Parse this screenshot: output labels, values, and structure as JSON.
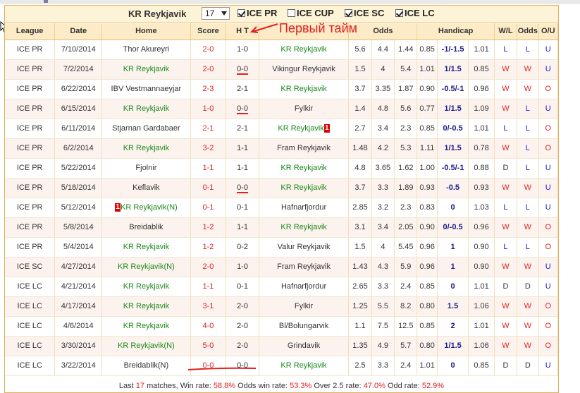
{
  "header": {
    "team": "KR Reykjavik",
    "count_value": "17",
    "filters": [
      {
        "label": "ICE PR",
        "checked": true
      },
      {
        "label": "ICE CUP",
        "checked": false
      },
      {
        "label": "ICE SC",
        "checked": true
      },
      {
        "label": "ICE LC",
        "checked": true
      }
    ]
  },
  "annotation": "Первый тайм",
  "columns": [
    "League",
    "Date",
    "Home",
    "Score",
    "H T",
    "Away",
    "Odds",
    "Handicap",
    "W/L",
    "Odds",
    "O/U"
  ],
  "rows": [
    {
      "league": "ICE PR",
      "date": "7/10/2014",
      "home": "Thor Akureyri",
      "home_team": false,
      "home_redcard": "",
      "score": "2-0",
      "ht": "1-0",
      "ht_marked": false,
      "away": "KR Reykjavik",
      "away_team": true,
      "away_redcard": "",
      "o1": "5.6",
      "o2": "4.4",
      "o3": "1.44",
      "h1": "0.85",
      "h2": "-1/-1.5",
      "h3": "1.01",
      "wl": "L",
      "odds": "L",
      "ou": "U"
    },
    {
      "league": "ICE PR",
      "date": "7/2/2014",
      "home": "KR Reykjavik",
      "home_team": true,
      "home_redcard": "",
      "score": "2-0",
      "ht": "0-0",
      "ht_marked": true,
      "away": "Vikingur Reykjavik",
      "away_team": false,
      "away_redcard": "",
      "o1": "1.5",
      "o2": "4",
      "o3": "5.4",
      "h1": "1.01",
      "h2": "1/1.5",
      "h3": "0.85",
      "wl": "W",
      "odds": "W",
      "ou": "U"
    },
    {
      "league": "ICE PR",
      "date": "6/22/2014",
      "home": "IBV Vestmannaeyjar",
      "home_team": false,
      "home_redcard": "",
      "score": "2-3",
      "ht": "2-1",
      "ht_marked": false,
      "away": "KR Reykjavik",
      "away_team": true,
      "away_redcard": "",
      "o1": "3.7",
      "o2": "3.35",
      "o3": "1.87",
      "h1": "0.90",
      "h2": "-0.5/-1",
      "h3": "0.96",
      "wl": "W",
      "odds": "W",
      "ou": "O"
    },
    {
      "league": "ICE PR",
      "date": "6/15/2014",
      "home": "KR Reykjavik",
      "home_team": true,
      "home_redcard": "",
      "score": "1-0",
      "ht": "0-0",
      "ht_marked": true,
      "away": "Fylkir",
      "away_team": false,
      "away_redcard": "",
      "o1": "1.4",
      "o2": "4.8",
      "o3": "5.6",
      "h1": "0.77",
      "h2": "1/1.5",
      "h3": "1.09",
      "wl": "W",
      "odds": "L",
      "ou": "U"
    },
    {
      "league": "ICE PR",
      "date": "6/11/2014",
      "home": "Stjarnan Gardabaer",
      "home_team": false,
      "home_redcard": "",
      "score": "2-1",
      "ht": "2-1",
      "ht_marked": false,
      "away": "KR Reykjavik",
      "away_team": true,
      "away_redcard": "1",
      "o1": "2.7",
      "o2": "3.4",
      "o3": "2.3",
      "h1": "0.85",
      "h2": "0/-0.5",
      "h3": "1.01",
      "wl": "L",
      "odds": "L",
      "ou": "O"
    },
    {
      "league": "ICE PR",
      "date": "6/2/2014",
      "home": "KR Reykjavik",
      "home_team": true,
      "home_redcard": "",
      "score": "3-2",
      "ht": "1-1",
      "ht_marked": false,
      "away": "Fram Reykjavik",
      "away_team": false,
      "away_redcard": "",
      "o1": "1.48",
      "o2": "4.2",
      "o3": "5.3",
      "h1": "1.11",
      "h2": "1/1.5",
      "h3": "0.78",
      "wl": "W",
      "odds": "L",
      "ou": "O"
    },
    {
      "league": "ICE PR",
      "date": "5/22/2014",
      "home": "Fjolnir",
      "home_team": false,
      "home_redcard": "",
      "score": "1-1",
      "ht": "1-1",
      "ht_marked": false,
      "away": "KR Reykjavik",
      "away_team": true,
      "away_redcard": "",
      "o1": "4.8",
      "o2": "3.65",
      "o3": "1.62",
      "h1": "1.00",
      "h2": "-0.5/-1",
      "h3": "0.88",
      "wl": "D",
      "odds": "L",
      "ou": "U"
    },
    {
      "league": "ICE PR",
      "date": "5/18/2014",
      "home": "Keflavik",
      "home_team": false,
      "home_redcard": "",
      "score": "0-1",
      "ht": "0-0",
      "ht_marked": true,
      "away": "KR Reykjavik",
      "away_team": true,
      "away_redcard": "",
      "o1": "3.7",
      "o2": "3.3",
      "o3": "1.89",
      "h1": "0.93",
      "h2": "-0.5",
      "h3": "0.93",
      "wl": "W",
      "odds": "W",
      "ou": "U"
    },
    {
      "league": "ICE PR",
      "date": "5/12/2014",
      "home": "KR Reykjavik(N)",
      "home_team": true,
      "home_redcard": "1",
      "score": "0-1",
      "ht": "0-1",
      "ht_marked": false,
      "away": "Hafnarfjordur",
      "away_team": false,
      "away_redcard": "",
      "o1": "2.85",
      "o2": "3.2",
      "o3": "2.3",
      "h1": "0.83",
      "h2": "0",
      "h3": "1.03",
      "wl": "L",
      "odds": "L",
      "ou": "U"
    },
    {
      "league": "ICE PR",
      "date": "5/8/2014",
      "home": "Breidablik",
      "home_team": false,
      "home_redcard": "",
      "score": "1-2",
      "ht": "1-1",
      "ht_marked": false,
      "away": "KR Reykjavik",
      "away_team": true,
      "away_redcard": "",
      "o1": "3.1",
      "o2": "3.4",
      "o3": "2.05",
      "h1": "0.90",
      "h2": "0/-0.5",
      "h3": "0.96",
      "wl": "W",
      "odds": "W",
      "ou": "O"
    },
    {
      "league": "ICE PR",
      "date": "5/4/2014",
      "home": "KR Reykjavik",
      "home_team": true,
      "home_redcard": "",
      "score": "1-2",
      "ht": "0-2",
      "ht_marked": false,
      "away": "Valur Reykjavik",
      "away_team": false,
      "away_redcard": "",
      "o1": "1.5",
      "o2": "4",
      "o3": "5.45",
      "h1": "0.96",
      "h2": "1",
      "h3": "0.90",
      "wl": "L",
      "odds": "L",
      "ou": "O"
    },
    {
      "league": "ICE SC",
      "date": "4/27/2014",
      "home": "KR Reykjavik(N)",
      "home_team": true,
      "home_redcard": "",
      "score": "2-0",
      "ht": "1-0",
      "ht_marked": false,
      "away": "Fram Reykjavik",
      "away_team": false,
      "away_redcard": "",
      "o1": "1.43",
      "o2": "4.3",
      "o3": "5.9",
      "h1": "0.96",
      "h2": "1",
      "h3": "0.90",
      "wl": "W",
      "odds": "W",
      "ou": "U"
    },
    {
      "league": "ICE LC",
      "date": "4/21/2014",
      "home": "KR Reykjavik",
      "home_team": true,
      "home_redcard": "",
      "score": "1-1",
      "ht": "0-1",
      "ht_marked": false,
      "away": "Hafnarfjordur",
      "away_team": false,
      "away_redcard": "",
      "o1": "2.65",
      "o2": "3.3",
      "o3": "2.4",
      "h1": "0.85",
      "h2": "0",
      "h3": "1.01",
      "wl": "D",
      "odds": "D",
      "ou": "U"
    },
    {
      "league": "ICE LC",
      "date": "4/17/2014",
      "home": "KR Reykjavik",
      "home_team": true,
      "home_redcard": "",
      "score": "3-1",
      "ht": "2-0",
      "ht_marked": false,
      "away": "Fylkir",
      "away_team": false,
      "away_redcard": "",
      "o1": "1.25",
      "o2": "5.5",
      "o3": "8.2",
      "h1": "0.80",
      "h2": "1.5",
      "h3": "1.06",
      "wl": "W",
      "odds": "W",
      "ou": "O"
    },
    {
      "league": "ICE LC",
      "date": "4/6/2014",
      "home": "KR Reykjavik",
      "home_team": true,
      "home_redcard": "",
      "score": "4-0",
      "ht": "2-0",
      "ht_marked": false,
      "away": "Bl/Bolungarvik",
      "away_team": false,
      "away_redcard": "",
      "o1": "1.1",
      "o2": "7.5",
      "o3": "12.5",
      "h1": "0.85",
      "h2": "2",
      "h3": "1.01",
      "wl": "W",
      "odds": "W",
      "ou": "O"
    },
    {
      "league": "ICE LC",
      "date": "3/30/2014",
      "home": "KR Reykjavik(N)",
      "home_team": true,
      "home_redcard": "",
      "score": "5-0",
      "ht": "2-0",
      "ht_marked": false,
      "away": "Grindavik",
      "away_team": false,
      "away_redcard": "",
      "o1": "1.35",
      "o2": "4.9",
      "o3": "5.7",
      "h1": "0.80",
      "h2": "1/1.5",
      "h3": "1.06",
      "wl": "W",
      "odds": "W",
      "ou": "O"
    },
    {
      "league": "ICE LC",
      "date": "3/22/2014",
      "home": "Breidablik(N)",
      "home_team": false,
      "home_redcard": "",
      "score": "0-0",
      "ht": "0-0",
      "ht_marked": false,
      "away": "KR Reykjavik",
      "away_team": true,
      "away_redcard": "",
      "o1": "2.5",
      "o2": "3.3",
      "o3": "2.4",
      "h1": "1.01",
      "h2": "0",
      "h3": "0.85",
      "wl": "D",
      "odds": "D",
      "ou": "U"
    }
  ],
  "footer": {
    "last_label": "Last",
    "match_count": "17",
    "matches_label": "matches, Win rate:",
    "win_rate": "58.8%",
    "odds_win_label": "Odds win rate:",
    "odds_win_rate": "53.3%",
    "over_label": "Over 2.5 rate:",
    "over_rate": "47.0%",
    "odd_label": "Odd rate:",
    "odd_rate": "52.9%"
  },
  "colors": {
    "team_green": "#1a8a1a",
    "score_red": "#e02020",
    "outcome_blue": "#1a1acc",
    "header_bg": "#fcebc6",
    "row_alt_bg": "#fdf3ee"
  }
}
